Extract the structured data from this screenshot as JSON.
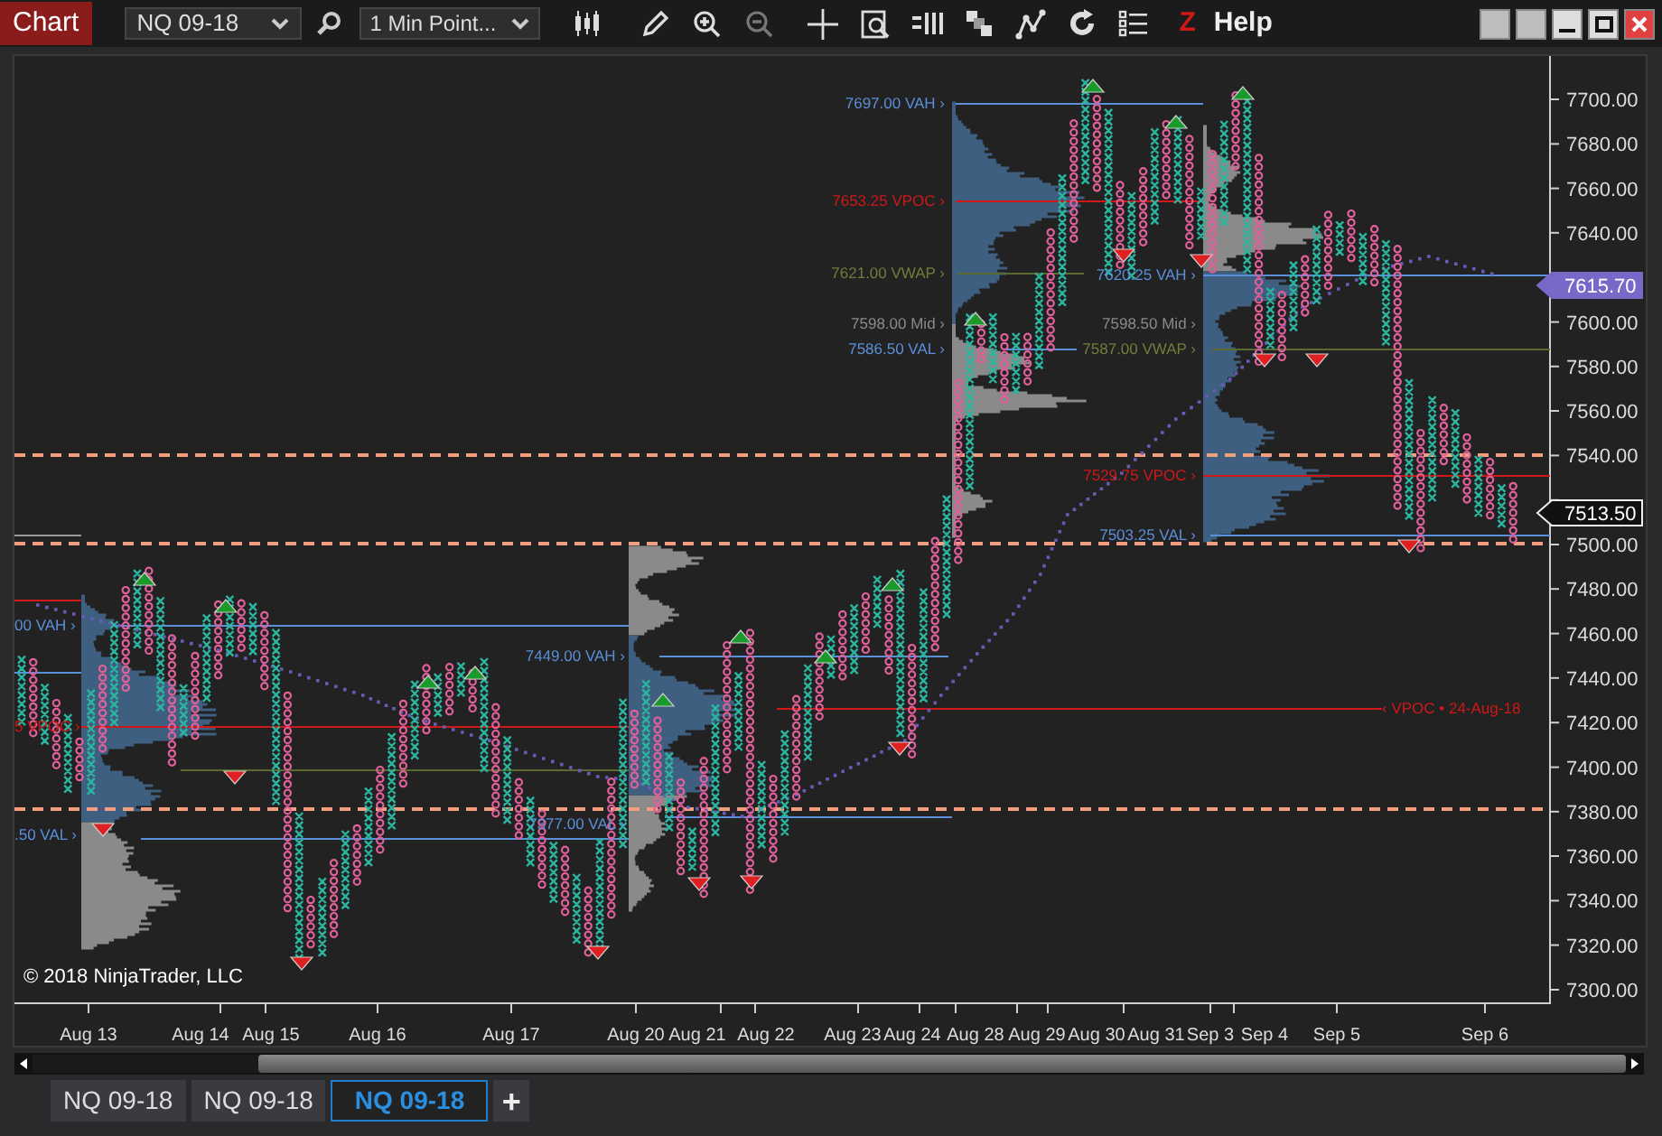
{
  "toolbar": {
    "title_button": "Chart",
    "instrument": "NQ 09-18",
    "interval": "1 Min Point...",
    "z_label": "Z",
    "help": "Help"
  },
  "chart": {
    "level_labels": [
      {
        "text": "7697.00 VAH ›",
        "kind": "vah"
      },
      {
        "text": "7653.25 VPOC ›",
        "kind": "vpoc"
      },
      {
        "text": "7621.00 VWAP ›",
        "kind": "vwap"
      },
      {
        "text": "7598.00 Mid ›",
        "kind": "mid"
      },
      {
        "text": "7586.50 VAL ›",
        "kind": "val"
      },
      {
        "text": "7620.25 VAH ›",
        "kind": "vah"
      },
      {
        "text": "7598.50 Mid ›",
        "kind": "mid"
      },
      {
        "text": "7587.00 VWAP ›",
        "kind": "vwap"
      },
      {
        "text": "7529.75 VPOC ›",
        "kind": "vpoc"
      },
      {
        "text": "7503.25 VAL ›",
        "kind": "val"
      },
      {
        "text": "7449.00 VAH ›",
        "kind": "vah"
      },
      {
        "text": "7377.00 VAL ›",
        "kind": "val"
      },
      {
        "text": "00 VAH ›",
        "kind": "vah"
      },
      {
        "text": "5 VPOC ›",
        "kind": "vpoc"
      },
      {
        "text": ".50 VAL ›",
        "kind": "val"
      },
      {
        "text": "‹ VPOC • 24-Aug-18",
        "kind": "vpoc"
      }
    ],
    "price_axis": [
      "7700.00",
      "7680.00",
      "7660.00",
      "7640.00",
      "7600.00",
      "7580.00",
      "7560.00",
      "7540.00",
      "7500.00",
      "7480.00",
      "7460.00",
      "7440.00",
      "7420.00",
      "7400.00",
      "7380.00",
      "7360.00",
      "7340.00",
      "7320.00",
      "7300.00"
    ],
    "price_markers": [
      {
        "text": "7615.70",
        "kind": "vwap"
      },
      {
        "text": "7513.50",
        "kind": "last"
      }
    ],
    "date_axis": [
      "Aug 13",
      "Aug 14",
      "Aug 15",
      "Aug 16",
      "Aug 17",
      "Aug 20",
      "Aug 21",
      "Aug 22",
      "Aug 23",
      "Aug 24",
      "Aug 28",
      "Aug 29",
      "Aug 30",
      "Aug 31",
      "Sep 3",
      "Sep 4",
      "Sep 5",
      "Sep 6"
    ],
    "copyright": "© 2018 NinjaTrader, LLC"
  },
  "tabs": [
    {
      "label": "NQ 09-18",
      "selected": false
    },
    {
      "label": "NQ 09-18",
      "selected": false
    },
    {
      "label": "NQ 09-18",
      "selected": true
    }
  ],
  "add_tab": "+"
}
